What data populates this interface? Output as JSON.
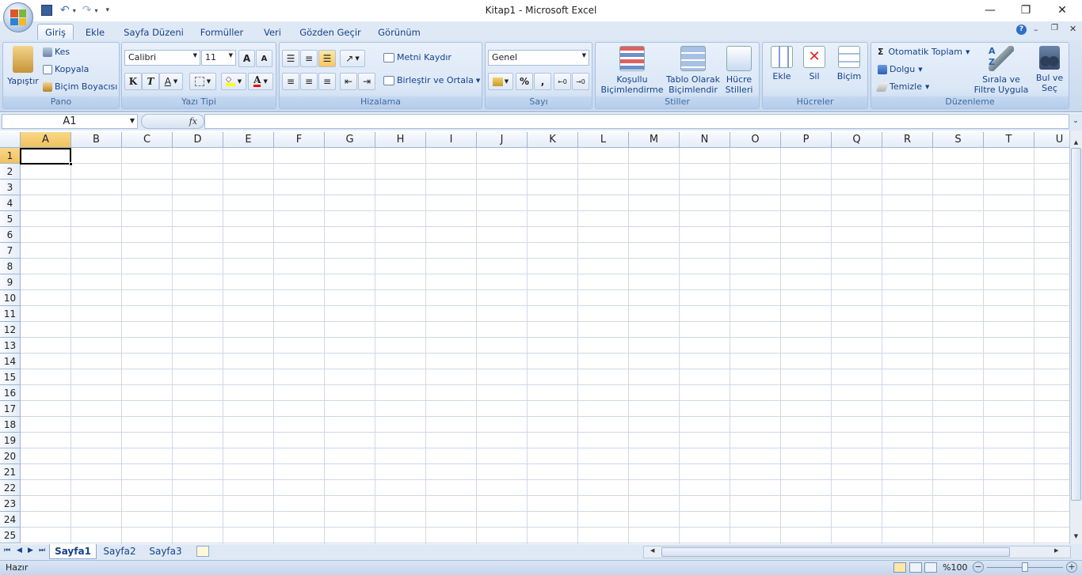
{
  "titlebar": {
    "title": "Kitap1 - Microsoft Excel",
    "minimize": "—",
    "restore": "❐",
    "close": "✕"
  },
  "tabs": [
    "Giriş",
    "Ekle",
    "Sayfa Düzeni",
    "Formüller",
    "Veri",
    "Gözden Geçir",
    "Görünüm"
  ],
  "ribbon": {
    "pano": {
      "label": "Pano",
      "paste": "Yapıştır",
      "cut": "Kes",
      "copy": "Kopyala",
      "format_painter": "Biçim Boyacısı"
    },
    "font": {
      "label": "Yazı Tipi",
      "name": "Calibri",
      "size": "11",
      "bold": "K",
      "italic": "T",
      "underline": "A",
      "grow": "A",
      "shrink": "A",
      "color": "A"
    },
    "alignment": {
      "label": "Hizalama",
      "wrap": "Metni Kaydır",
      "merge": "Birleştir ve Ortala"
    },
    "number": {
      "label": "Sayı",
      "format": "Genel",
      "percent": "%",
      "comma": ","
    },
    "styles": {
      "label": "Stiller",
      "conditional": "Koşullu Biçimlendirme",
      "table": "Tablo Olarak Biçimlendir",
      "cell": "Hücre Stilleri"
    },
    "cells": {
      "label": "Hücreler",
      "insert": "Ekle",
      "delete": "Sil",
      "format": "Biçim"
    },
    "editing": {
      "label": "Düzenleme",
      "autosum": "Otomatik Toplam",
      "fill": "Dolgu",
      "clear": "Temizle",
      "sort": "Sırala ve Filtre Uygula",
      "find": "Bul ve Seç"
    }
  },
  "formula": {
    "namebox": "A1",
    "fx": "fx",
    "value": ""
  },
  "columns": [
    "A",
    "B",
    "C",
    "D",
    "E",
    "F",
    "G",
    "H",
    "I",
    "J",
    "K",
    "L",
    "M",
    "N",
    "O",
    "P",
    "Q",
    "R",
    "S",
    "T",
    "U"
  ],
  "rows": [
    "1",
    "2",
    "3",
    "4",
    "5",
    "6",
    "7",
    "8",
    "9",
    "10",
    "11",
    "12",
    "13",
    "14",
    "15",
    "16",
    "17",
    "18",
    "19",
    "20",
    "21",
    "22",
    "23",
    "24",
    "25"
  ],
  "sheets": [
    "Sayfa1",
    "Sayfa2",
    "Sayfa3"
  ],
  "status": {
    "ready": "Hazır",
    "zoom": "%100"
  },
  "colors": {
    "accent": "#15428b",
    "ribbon_bg": "#dbe6f4",
    "selected_header": "#f5cd7a"
  }
}
